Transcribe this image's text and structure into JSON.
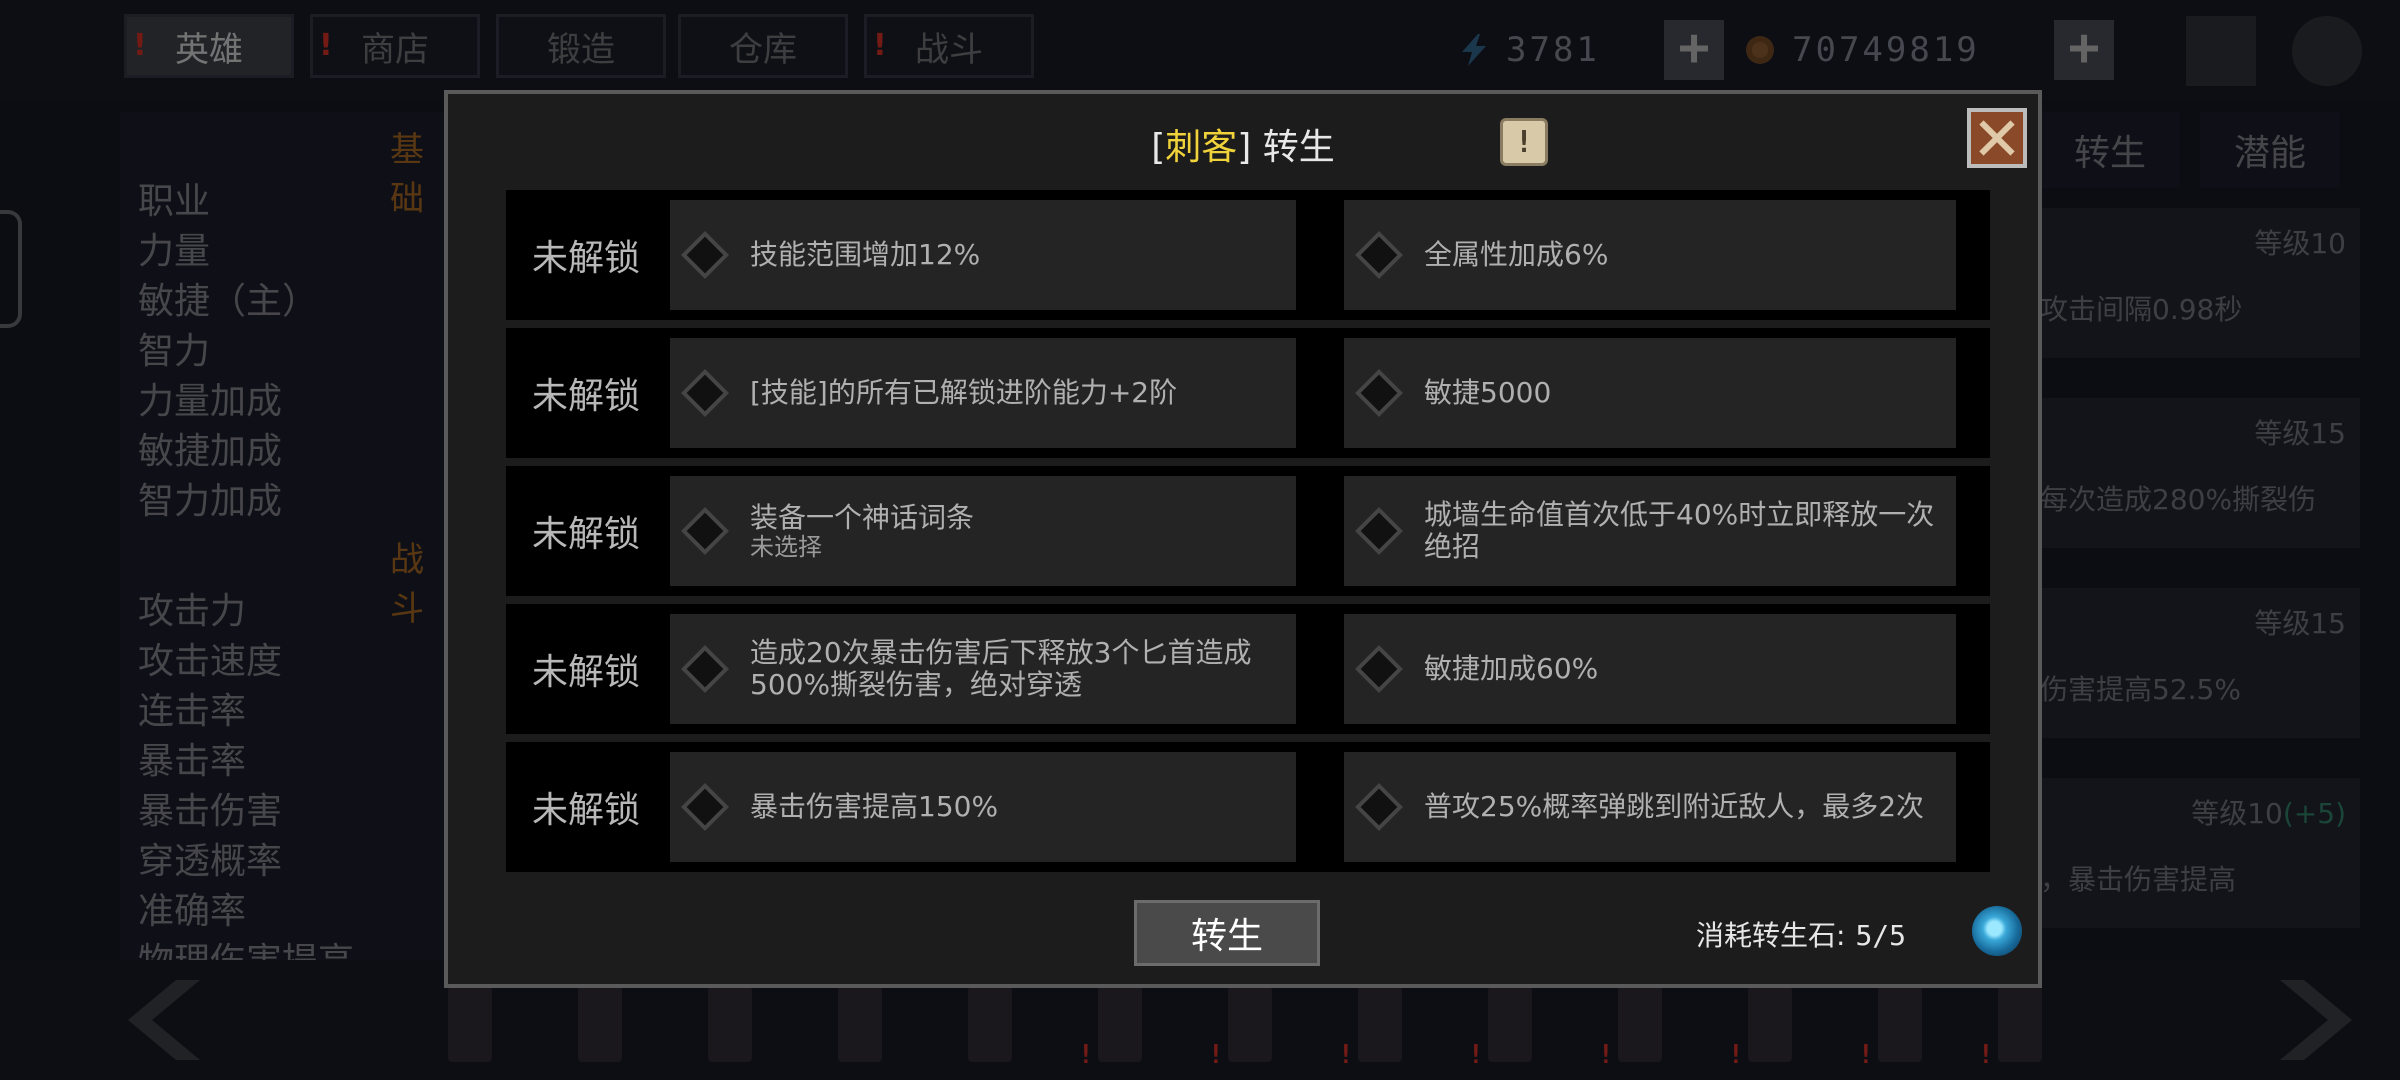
{
  "top_tabs": [
    {
      "label": "英雄",
      "active": true,
      "alert": true
    },
    {
      "label": "商店",
      "active": false,
      "alert": true
    },
    {
      "label": "锻造",
      "active": false,
      "alert": false
    },
    {
      "label": "仓库",
      "active": false,
      "alert": false
    },
    {
      "label": "战斗",
      "active": false,
      "alert": true
    }
  ],
  "resources": {
    "energy": "3781",
    "coins": "70749819"
  },
  "left_panel": {
    "section_basic": "基础",
    "section_combat": "战斗",
    "basic_stats": [
      "职业",
      "力量",
      "敏捷（主）",
      "智力",
      "力量加成",
      "敏捷加成",
      "智力加成"
    ],
    "combat_stats": [
      "攻击力",
      "攻击速度",
      "连击率",
      "暴击率",
      "暴击伤害",
      "穿透概率",
      "准确率",
      "物理伤害提高"
    ]
  },
  "right_panel": {
    "tabs": [
      "转生",
      "潜能"
    ],
    "cards": [
      {
        "level": "等级10",
        "desc": "攻击间隔0.98秒"
      },
      {
        "level": "等级15",
        "desc": "每次造成280%撕裂伤"
      },
      {
        "level": "等级15",
        "desc": "伤害提高52.5%"
      },
      {
        "level": "等级10",
        "bonus": "(+5)",
        "desc": "，暴击伤害提高"
      }
    ]
  },
  "modal": {
    "class_name": "刺客",
    "title_suffix": "转生",
    "info_label": "!",
    "rows": [
      {
        "status": "未解锁",
        "left": "技能范围增加12%",
        "right": "全属性加成6%"
      },
      {
        "status": "未解锁",
        "left": "[技能]的所有已解锁进阶能力+2阶",
        "right": "敏捷5000"
      },
      {
        "status": "未解锁",
        "left": "装备一个神话词条",
        "left_sub": "未选择",
        "right": "城墙生命值首次低于40%时立即释放一次绝招"
      },
      {
        "status": "未解锁",
        "left": "造成20次暴击伤害后下释放3个匕首造成500%撕裂伤害，绝对穿透",
        "right": "敏捷加成60%"
      },
      {
        "status": "未解锁",
        "left": "暴击伤害提高150%",
        "right": "普攻25%概率弹跳到附近敌人，最多2次"
      }
    ],
    "rebirth_button": "转生",
    "cost_label": "消耗转生石:",
    "cost_value": "5/5"
  },
  "colors": {
    "class_name": "#f0d33a",
    "alert": "#ff3b30",
    "section_header": "#c47a28"
  }
}
